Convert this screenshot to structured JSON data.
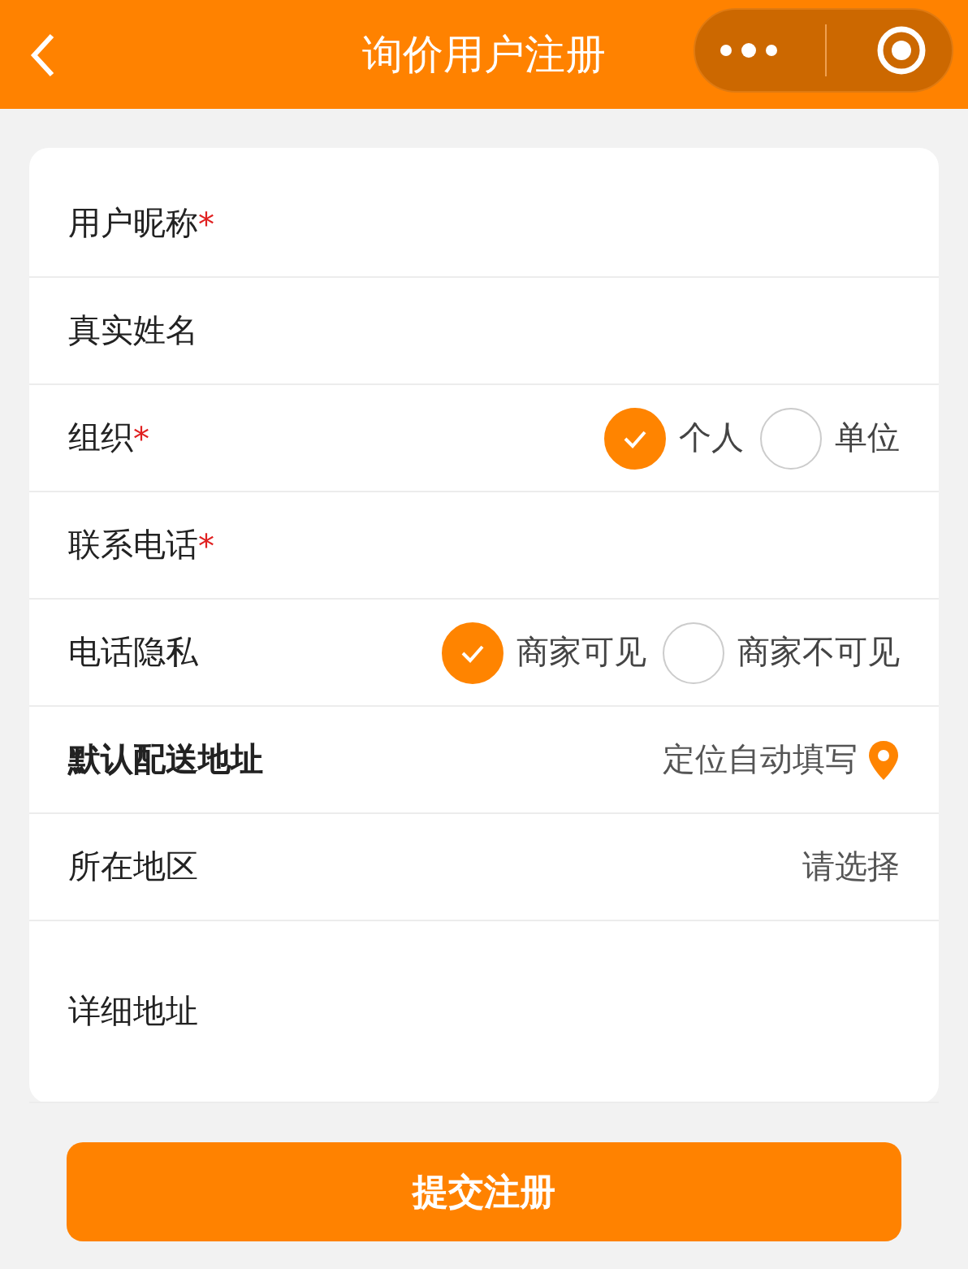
{
  "header": {
    "title": "询价用户注册"
  },
  "form": {
    "rows": [
      {
        "kind": "text",
        "label": "用户昵称",
        "mark": "*"
      },
      {
        "kind": "text",
        "label": "真实姓名"
      },
      {
        "kind": "radio",
        "label": "组织",
        "mark": "*",
        "options": [
          {
            "label": "个人",
            "selected": true
          },
          {
            "label": "单位",
            "selected": false
          }
        ]
      },
      {
        "kind": "text",
        "label": "联系电话",
        "mark": "*"
      },
      {
        "kind": "radio",
        "label": "电话隐私",
        "options": [
          {
            "label": "商家可见",
            "selected": true
          },
          {
            "label": "商家不可见",
            "selected": false
          }
        ]
      },
      {
        "kind": "locate",
        "label": "默认配送地址",
        "hint": "定位自动填写"
      },
      {
        "kind": "select",
        "label": "所在地区",
        "hint": "请选择"
      },
      {
        "kind": "textarea",
        "label": "详细地址"
      }
    ]
  },
  "submit": {
    "label": "提交注册"
  }
}
